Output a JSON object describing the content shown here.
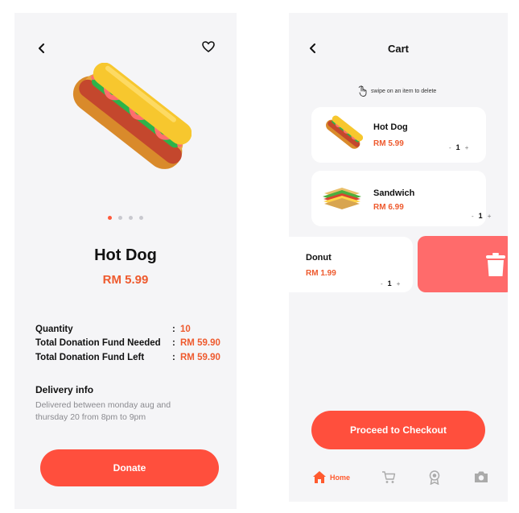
{
  "detail": {
    "title": "Hot Dog",
    "price": "RM 5.99",
    "carousel_active": 0,
    "carousel_count": 4,
    "info": [
      {
        "label": "Quantity",
        "value": "10"
      },
      {
        "label": "Total Donation Fund Needed",
        "value": "RM 59.90"
      },
      {
        "label": "Total Donation Fund Left",
        "value": "RM 59.90"
      }
    ],
    "delivery_title": "Delivery info",
    "delivery_text": "Delivered between monday aug and thursday 20 from 8pm to 9pm",
    "donate_label": "Donate",
    "icons": {
      "back": "chevron-left-icon",
      "favorite": "heart-icon"
    }
  },
  "cart": {
    "title": "Cart",
    "hint": "swipe on an item to delete",
    "items": [
      {
        "name": "Hot Dog",
        "price": "RM 5.99",
        "qty": "1"
      },
      {
        "name": "Sandwich",
        "price": "RM 6.99",
        "qty": "1"
      },
      {
        "name": "Donut",
        "price": "RM 1.99",
        "qty": "1"
      }
    ],
    "checkout_label": "Proceed to Checkout",
    "nav": [
      {
        "label": "Home",
        "icon": "home-icon",
        "active": true
      },
      {
        "label": "",
        "icon": "cart-icon",
        "active": false
      },
      {
        "label": "",
        "icon": "award-icon",
        "active": false
      },
      {
        "label": "",
        "icon": "camera-icon",
        "active": false
      }
    ]
  },
  "colors": {
    "accent": "#ff4f3d",
    "price": "#ee5a2e",
    "background": "#f5f5f7",
    "delete": "#ff6b6b"
  }
}
